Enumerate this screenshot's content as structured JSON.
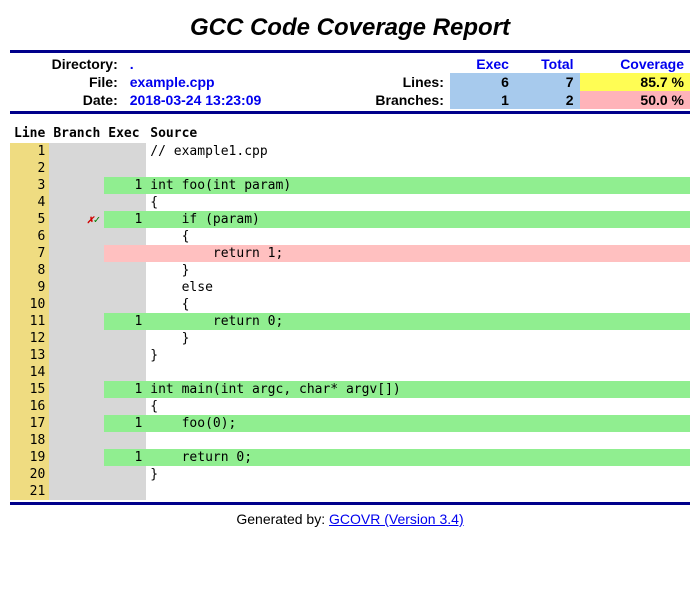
{
  "title": "GCC Code Coverage Report",
  "labels": {
    "directory": "Directory:",
    "file": "File:",
    "date": "Date:",
    "exec": "Exec",
    "total": "Total",
    "coverage": "Coverage",
    "lines": "Lines:",
    "branches": "Branches:"
  },
  "header": {
    "directory": ".",
    "file": "example.cpp",
    "date": "2018-03-24 13:23:09",
    "lines_exec": "6",
    "lines_total": "7",
    "lines_cov": "85.7 %",
    "branches_exec": "1",
    "branches_total": "2",
    "branches_cov": "50.0 %"
  },
  "columns": {
    "line": "Line",
    "branch": "Branch",
    "exec": "Exec",
    "source": "Source"
  },
  "rows": [
    {
      "n": "1",
      "b": "",
      "e": "",
      "s": "// example1.cpp",
      "ec": "",
      "sc": ""
    },
    {
      "n": "2",
      "b": "",
      "e": "",
      "s": "",
      "ec": "",
      "sc": ""
    },
    {
      "n": "3",
      "b": "",
      "e": "1",
      "s": "int foo(int param)",
      "ec": "bg-green",
      "sc": "bg-green"
    },
    {
      "n": "4",
      "b": "",
      "e": "",
      "s": "{",
      "ec": "",
      "sc": ""
    },
    {
      "n": "5",
      "b": "xv",
      "e": "1",
      "s": "    if (param)",
      "ec": "bg-green",
      "sc": "bg-green"
    },
    {
      "n": "6",
      "b": "",
      "e": "",
      "s": "    {",
      "ec": "",
      "sc": ""
    },
    {
      "n": "7",
      "b": "",
      "e": "",
      "s": "        return 1;",
      "ec": "bg-pink",
      "sc": "bg-pink"
    },
    {
      "n": "8",
      "b": "",
      "e": "",
      "s": "    }",
      "ec": "",
      "sc": ""
    },
    {
      "n": "9",
      "b": "",
      "e": "",
      "s": "    else",
      "ec": "",
      "sc": ""
    },
    {
      "n": "10",
      "b": "",
      "e": "",
      "s": "    {",
      "ec": "",
      "sc": ""
    },
    {
      "n": "11",
      "b": "",
      "e": "1",
      "s": "        return 0;",
      "ec": "bg-green",
      "sc": "bg-green"
    },
    {
      "n": "12",
      "b": "",
      "e": "",
      "s": "    }",
      "ec": "",
      "sc": ""
    },
    {
      "n": "13",
      "b": "",
      "e": "",
      "s": "}",
      "ec": "",
      "sc": ""
    },
    {
      "n": "14",
      "b": "",
      "e": "",
      "s": "",
      "ec": "",
      "sc": ""
    },
    {
      "n": "15",
      "b": "",
      "e": "1",
      "s": "int main(int argc, char* argv[])",
      "ec": "bg-green",
      "sc": "bg-green"
    },
    {
      "n": "16",
      "b": "",
      "e": "",
      "s": "{",
      "ec": "",
      "sc": ""
    },
    {
      "n": "17",
      "b": "",
      "e": "1",
      "s": "    foo(0);",
      "ec": "bg-green",
      "sc": "bg-green"
    },
    {
      "n": "18",
      "b": "",
      "e": "",
      "s": "",
      "ec": "",
      "sc": ""
    },
    {
      "n": "19",
      "b": "",
      "e": "1",
      "s": "    return 0;",
      "ec": "bg-green",
      "sc": "bg-green"
    },
    {
      "n": "20",
      "b": "",
      "e": "",
      "s": "}",
      "ec": "",
      "sc": ""
    },
    {
      "n": "21",
      "b": "",
      "e": "",
      "s": "",
      "ec": "",
      "sc": ""
    }
  ],
  "footer": {
    "prefix": "Generated by: ",
    "link": "GCOVR (Version 3.4)"
  }
}
